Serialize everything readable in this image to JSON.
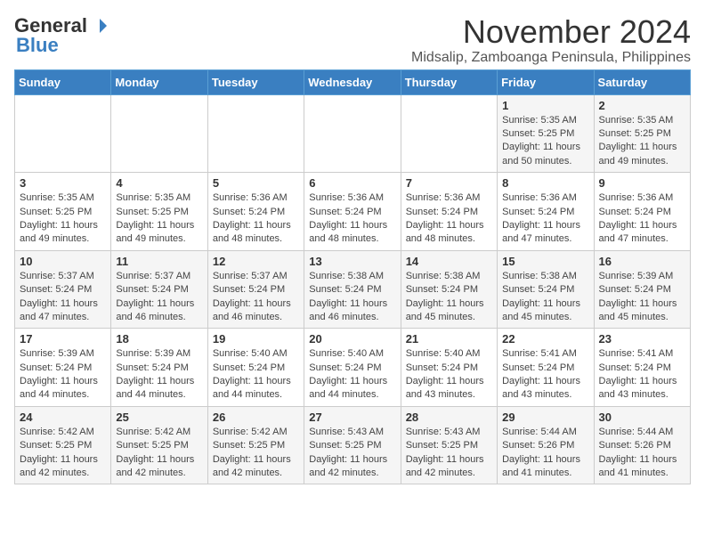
{
  "header": {
    "logo_general": "General",
    "logo_blue": "Blue",
    "month_title": "November 2024",
    "location": "Midsalip, Zamboanga Peninsula, Philippines"
  },
  "weekdays": [
    "Sunday",
    "Monday",
    "Tuesday",
    "Wednesday",
    "Thursday",
    "Friday",
    "Saturday"
  ],
  "weeks": [
    [
      {
        "day": "",
        "info": ""
      },
      {
        "day": "",
        "info": ""
      },
      {
        "day": "",
        "info": ""
      },
      {
        "day": "",
        "info": ""
      },
      {
        "day": "",
        "info": ""
      },
      {
        "day": "1",
        "info": "Sunrise: 5:35 AM\nSunset: 5:25 PM\nDaylight: 11 hours\nand 50 minutes."
      },
      {
        "day": "2",
        "info": "Sunrise: 5:35 AM\nSunset: 5:25 PM\nDaylight: 11 hours\nand 49 minutes."
      }
    ],
    [
      {
        "day": "3",
        "info": "Sunrise: 5:35 AM\nSunset: 5:25 PM\nDaylight: 11 hours\nand 49 minutes."
      },
      {
        "day": "4",
        "info": "Sunrise: 5:35 AM\nSunset: 5:25 PM\nDaylight: 11 hours\nand 49 minutes."
      },
      {
        "day": "5",
        "info": "Sunrise: 5:36 AM\nSunset: 5:24 PM\nDaylight: 11 hours\nand 48 minutes."
      },
      {
        "day": "6",
        "info": "Sunrise: 5:36 AM\nSunset: 5:24 PM\nDaylight: 11 hours\nand 48 minutes."
      },
      {
        "day": "7",
        "info": "Sunrise: 5:36 AM\nSunset: 5:24 PM\nDaylight: 11 hours\nand 48 minutes."
      },
      {
        "day": "8",
        "info": "Sunrise: 5:36 AM\nSunset: 5:24 PM\nDaylight: 11 hours\nand 47 minutes."
      },
      {
        "day": "9",
        "info": "Sunrise: 5:36 AM\nSunset: 5:24 PM\nDaylight: 11 hours\nand 47 minutes."
      }
    ],
    [
      {
        "day": "10",
        "info": "Sunrise: 5:37 AM\nSunset: 5:24 PM\nDaylight: 11 hours\nand 47 minutes."
      },
      {
        "day": "11",
        "info": "Sunrise: 5:37 AM\nSunset: 5:24 PM\nDaylight: 11 hours\nand 46 minutes."
      },
      {
        "day": "12",
        "info": "Sunrise: 5:37 AM\nSunset: 5:24 PM\nDaylight: 11 hours\nand 46 minutes."
      },
      {
        "day": "13",
        "info": "Sunrise: 5:38 AM\nSunset: 5:24 PM\nDaylight: 11 hours\nand 46 minutes."
      },
      {
        "day": "14",
        "info": "Sunrise: 5:38 AM\nSunset: 5:24 PM\nDaylight: 11 hours\nand 45 minutes."
      },
      {
        "day": "15",
        "info": "Sunrise: 5:38 AM\nSunset: 5:24 PM\nDaylight: 11 hours\nand 45 minutes."
      },
      {
        "day": "16",
        "info": "Sunrise: 5:39 AM\nSunset: 5:24 PM\nDaylight: 11 hours\nand 45 minutes."
      }
    ],
    [
      {
        "day": "17",
        "info": "Sunrise: 5:39 AM\nSunset: 5:24 PM\nDaylight: 11 hours\nand 44 minutes."
      },
      {
        "day": "18",
        "info": "Sunrise: 5:39 AM\nSunset: 5:24 PM\nDaylight: 11 hours\nand 44 minutes."
      },
      {
        "day": "19",
        "info": "Sunrise: 5:40 AM\nSunset: 5:24 PM\nDaylight: 11 hours\nand 44 minutes."
      },
      {
        "day": "20",
        "info": "Sunrise: 5:40 AM\nSunset: 5:24 PM\nDaylight: 11 hours\nand 44 minutes."
      },
      {
        "day": "21",
        "info": "Sunrise: 5:40 AM\nSunset: 5:24 PM\nDaylight: 11 hours\nand 43 minutes."
      },
      {
        "day": "22",
        "info": "Sunrise: 5:41 AM\nSunset: 5:24 PM\nDaylight: 11 hours\nand 43 minutes."
      },
      {
        "day": "23",
        "info": "Sunrise: 5:41 AM\nSunset: 5:24 PM\nDaylight: 11 hours\nand 43 minutes."
      }
    ],
    [
      {
        "day": "24",
        "info": "Sunrise: 5:42 AM\nSunset: 5:25 PM\nDaylight: 11 hours\nand 42 minutes."
      },
      {
        "day": "25",
        "info": "Sunrise: 5:42 AM\nSunset: 5:25 PM\nDaylight: 11 hours\nand 42 minutes."
      },
      {
        "day": "26",
        "info": "Sunrise: 5:42 AM\nSunset: 5:25 PM\nDaylight: 11 hours\nand 42 minutes."
      },
      {
        "day": "27",
        "info": "Sunrise: 5:43 AM\nSunset: 5:25 PM\nDaylight: 11 hours\nand 42 minutes."
      },
      {
        "day": "28",
        "info": "Sunrise: 5:43 AM\nSunset: 5:25 PM\nDaylight: 11 hours\nand 42 minutes."
      },
      {
        "day": "29",
        "info": "Sunrise: 5:44 AM\nSunset: 5:26 PM\nDaylight: 11 hours\nand 41 minutes."
      },
      {
        "day": "30",
        "info": "Sunrise: 5:44 AM\nSunset: 5:26 PM\nDaylight: 11 hours\nand 41 minutes."
      }
    ]
  ]
}
